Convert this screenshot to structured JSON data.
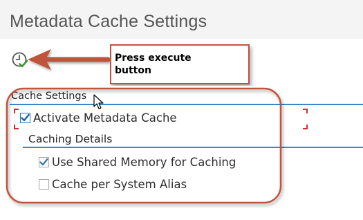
{
  "page": {
    "title": "Metadata Cache Settings"
  },
  "toolbar": {
    "execute_icon": "execute-clock-check-icon"
  },
  "annotation": {
    "callout_line1": "Press execute",
    "callout_line2": "button"
  },
  "cache_settings": {
    "group_title": "Cache Settings",
    "activate_label": "Activate Metadata Cache",
    "activate_checked": true,
    "details_title": "Caching Details",
    "options": [
      {
        "label": "Use Shared Memory for Caching",
        "checked": true
      },
      {
        "label": "Cache per System Alias",
        "checked": false
      }
    ]
  },
  "colors": {
    "annotation_red": "#c0533a",
    "divider_blue": "#3a86c7",
    "check_blue": "#2a72b5",
    "focus_red": "#d62b2b"
  }
}
